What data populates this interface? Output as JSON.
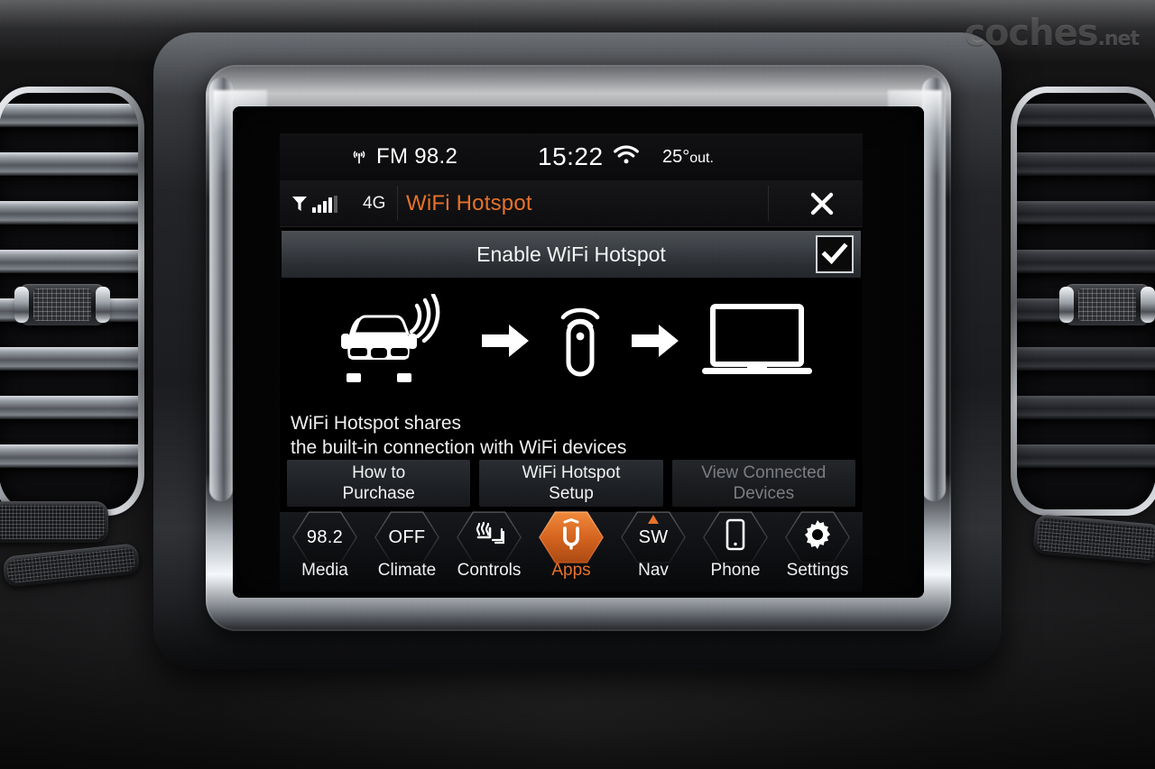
{
  "watermark": {
    "text": "coches",
    "suffix": ".net"
  },
  "statusbar": {
    "radio_icon": "broadcast-icon",
    "radio_band": "FM 98.2",
    "time": "15:22",
    "wifi_icon": "wifi-icon",
    "temperature": "25°",
    "temperature_suffix": "out."
  },
  "titlebar": {
    "signal_icon": "cellular-signal-icon",
    "network": "4G",
    "title": "WiFi Hotspot",
    "close_icon": "close-icon",
    "accent_color": "#e8722a"
  },
  "enable_row": {
    "label": "Enable WiFi Hotspot",
    "checked": true,
    "check_icon": "checkmark-icon"
  },
  "illustration": {
    "items": [
      {
        "icon": "car-broadcasting-icon",
        "name": "car"
      },
      {
        "icon": "arrow-right-icon",
        "name": "arrow-1"
      },
      {
        "icon": "hotspot-device-icon",
        "name": "hotspot-device"
      },
      {
        "icon": "arrow-right-icon",
        "name": "arrow-2"
      },
      {
        "icon": "laptop-icon",
        "name": "laptop"
      }
    ]
  },
  "description": {
    "line1": "WiFi Hotspot shares",
    "line2": "the built-in connection with WiFi devices"
  },
  "actions": [
    {
      "line1": "How to",
      "line2": "Purchase",
      "disabled": false
    },
    {
      "line1": "WiFi Hotspot",
      "line2": "Setup",
      "disabled": false
    },
    {
      "line1": "View Connected",
      "line2": "Devices",
      "disabled": true
    }
  ],
  "navbar": {
    "items": [
      {
        "label": "Media",
        "value": "98.2",
        "icon": "radio-frequency-icon",
        "active": false
      },
      {
        "label": "Climate",
        "value": "OFF",
        "icon": "climate-off-icon",
        "active": false
      },
      {
        "label": "Controls",
        "value": "",
        "icon": "heated-seat-icon",
        "active": false
      },
      {
        "label": "Apps",
        "value": "",
        "icon": "uconnect-logo-icon",
        "active": true
      },
      {
        "label": "Nav",
        "value": "SW",
        "icon": "compass-heading-icon",
        "active": false
      },
      {
        "label": "Phone",
        "value": "",
        "icon": "smartphone-icon",
        "active": false
      },
      {
        "label": "Settings",
        "value": "",
        "icon": "gear-icon",
        "active": false
      }
    ]
  }
}
